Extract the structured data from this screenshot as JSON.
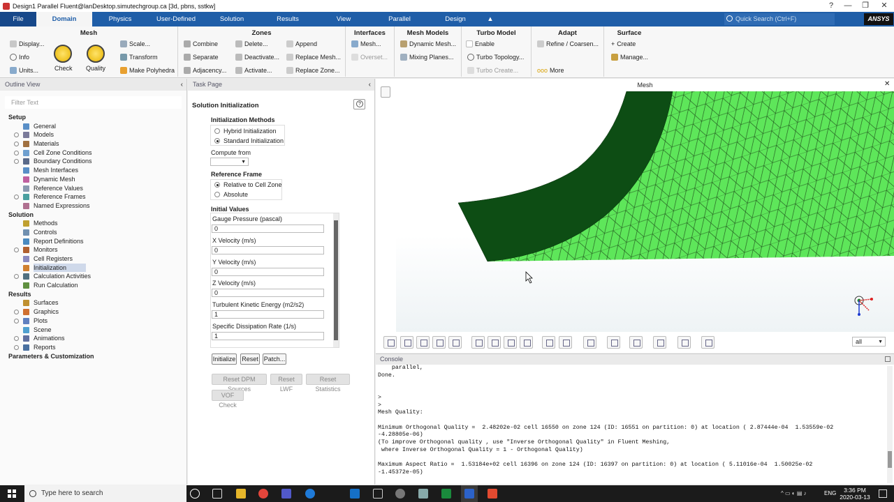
{
  "window": {
    "title": "Design1 Parallel Fluent@lanDesktop.simutechgroup.ca  [3d, pbns, sstkw]",
    "controls": [
      "?",
      "—",
      "❐",
      "✕"
    ]
  },
  "tabs": [
    "File",
    "Domain",
    "Physics",
    "User-Defined",
    "Solution",
    "Results",
    "View",
    "Parallel",
    "Design"
  ],
  "quick_search": "Quick Search (Ctrl+F)",
  "brand": "ANSYS",
  "ribbon": {
    "mesh": {
      "title": "Mesh",
      "display": "Display...",
      "info": "Info",
      "units": "Units...",
      "check": "Check",
      "quality": "Quality",
      "scale": "Scale...",
      "transform": "Transform",
      "make_polyhedra": "Make Polyhedra"
    },
    "zones": {
      "title": "Zones",
      "combine": "Combine",
      "separate": "Separate",
      "adjacency": "Adjacency...",
      "delete": "Delete...",
      "deactivate": "Deactivate...",
      "activate": "Activate...",
      "append": "Append",
      "replace_mesh": "Replace Mesh...",
      "replace_zone": "Replace Zone..."
    },
    "interfaces": {
      "title": "Interfaces",
      "mesh": "Mesh...",
      "overset": "Overset..."
    },
    "mesh_models": {
      "title": "Mesh Models",
      "dynamic": "Dynamic Mesh...",
      "mixing": "Mixing Planes..."
    },
    "turbo": {
      "title": "Turbo Model",
      "enable": "Enable",
      "topology": "Turbo Topology...",
      "create": "Turbo Create..."
    },
    "adapt": {
      "title": "Adapt",
      "refine": "Refine / Coarsen...",
      "more": "More"
    },
    "surface": {
      "title": "Surface",
      "create": "Create",
      "manage": "Manage..."
    }
  },
  "outline": {
    "header": "Outline View",
    "filter_placeholder": "Filter Text",
    "items": [
      {
        "label": "Setup",
        "level": 0,
        "header": true,
        "exp": true
      },
      {
        "label": "General",
        "level": 1,
        "color": "#5a8fc7"
      },
      {
        "label": "Models",
        "level": 1,
        "color": "#7a7a9a",
        "exp": true
      },
      {
        "label": "Materials",
        "level": 1,
        "color": "#a07040",
        "exp": true
      },
      {
        "label": "Cell Zone Conditions",
        "level": 1,
        "color": "#6fa0d0",
        "exp": true
      },
      {
        "label": "Boundary Conditions",
        "level": 1,
        "color": "#5a6a8a",
        "exp": true
      },
      {
        "label": "Mesh Interfaces",
        "level": 1,
        "color": "#5a8fc7"
      },
      {
        "label": "Dynamic Mesh",
        "level": 1,
        "color": "#c060a0"
      },
      {
        "label": "Reference Values",
        "level": 1,
        "color": "#8a9ab0"
      },
      {
        "label": "Reference Frames",
        "level": 1,
        "color": "#4aa0a0",
        "exp": true
      },
      {
        "label": "Named Expressions",
        "level": 1,
        "color": "#b07090"
      },
      {
        "label": "Solution",
        "level": 0,
        "header": true,
        "exp": true
      },
      {
        "label": "Methods",
        "level": 1,
        "color": "#c0a030"
      },
      {
        "label": "Controls",
        "level": 1,
        "color": "#7090b0"
      },
      {
        "label": "Report Definitions",
        "level": 1,
        "color": "#4a8ac0"
      },
      {
        "label": "Monitors",
        "level": 1,
        "color": "#b06030",
        "exp": true
      },
      {
        "label": "Cell Registers",
        "level": 1,
        "color": "#8a8ac0"
      },
      {
        "label": "Initialization",
        "level": 1,
        "color": "#d08030",
        "sel": true
      },
      {
        "label": "Calculation Activities",
        "level": 1,
        "color": "#507080",
        "exp": true
      },
      {
        "label": "Run Calculation",
        "level": 1,
        "color": "#609040"
      },
      {
        "label": "Results",
        "level": 0,
        "header": true,
        "exp": true
      },
      {
        "label": "Surfaces",
        "level": 1,
        "color": "#c09030"
      },
      {
        "label": "Graphics",
        "level": 1,
        "color": "#d07030",
        "exp": true
      },
      {
        "label": "Plots",
        "level": 1,
        "color": "#6080c0",
        "exp": true
      },
      {
        "label": "Scene",
        "level": 1,
        "color": "#50a0d0"
      },
      {
        "label": "Animations",
        "level": 1,
        "color": "#6070a0",
        "exp": true
      },
      {
        "label": "Reports",
        "level": 1,
        "color": "#4a70a0",
        "exp": true
      },
      {
        "label": "Parameters & Customization",
        "level": 0,
        "header": true,
        "exp": true
      }
    ]
  },
  "task": {
    "header": "Task Page",
    "title": "Solution Initialization",
    "methods_label": "Initialization Methods",
    "hybrid": "Hybrid  Initialization",
    "standard": "Standard Initialization",
    "compute_from": "Compute from",
    "ref_frame_label": "Reference Frame",
    "relative": "Relative to Cell Zone",
    "absolute": "Absolute",
    "initial_values": "Initial Values",
    "fields": [
      {
        "label": "Gauge Pressure (pascal)",
        "value": "0"
      },
      {
        "label": "X Velocity (m/s)",
        "value": "0"
      },
      {
        "label": "Y Velocity (m/s)",
        "value": "0"
      },
      {
        "label": "Z Velocity (m/s)",
        "value": "0"
      },
      {
        "label": "Turbulent Kinetic Energy (m2/s2)",
        "value": "1"
      },
      {
        "label": "Specific Dissipation Rate (1/s)",
        "value": "1"
      }
    ],
    "buttons": [
      "Initialize",
      "Reset",
      "Patch..."
    ],
    "disabled_buttons": [
      "Reset DPM Sources",
      "Reset LWF",
      "Reset Statistics"
    ],
    "vof_check": "VOF Check"
  },
  "viewport": {
    "title": "Mesh",
    "filter": "all",
    "mesh_fill": "#5ee65a",
    "wall_fill": "#0d4d14"
  },
  "console": {
    "header": "Console",
    "text": "    parallel,\nDone.\n\n\n>\n>\nMesh Quality:\n\nMinimum Orthogonal Quality =  2.48202e-02 cell 16550 on zone 124 (ID: 16551 on partition: 0) at location ( 2.87444e-04  1.53559e-02\n-4.28805e-06)\n(To improve Orthogonal quality , use \"Inverse Orthogonal Quality\" in Fluent Meshing,\n where Inverse Orthogonal Quality = 1 - Orthogonal Quality)\n\nMaximum Aspect Ratio =  1.53184e+02 cell 16396 on zone 124 (ID: 16397 on partition: 0) at location ( 5.11016e-04  1.50025e-02\n-1.45372e-05)"
  },
  "taskbar": {
    "search": "Type here to search",
    "lang": "ENG",
    "time": "3:36 PM",
    "date": "2020-03-13"
  }
}
